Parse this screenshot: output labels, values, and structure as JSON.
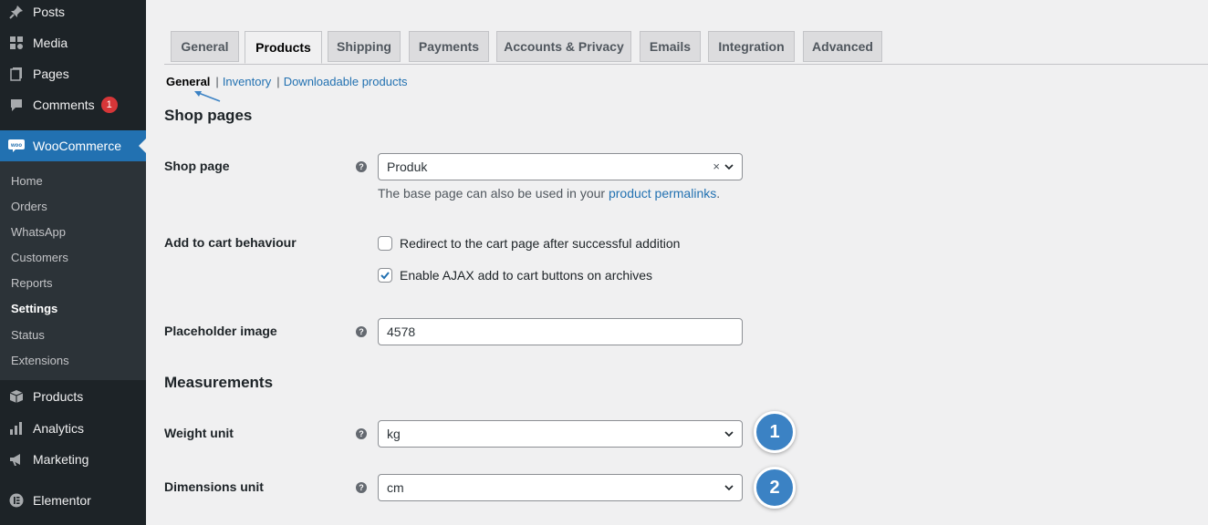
{
  "sidebar": {
    "top_items": [
      {
        "label": "Posts",
        "icon": "pin-icon"
      },
      {
        "label": "Media",
        "icon": "media-icon"
      },
      {
        "label": "Pages",
        "icon": "pages-icon"
      },
      {
        "label": "Comments",
        "icon": "comment-icon",
        "badge": "1"
      }
    ],
    "woocommerce": {
      "label": "WooCommerce",
      "icon_text": "woo"
    },
    "submenu": [
      "Home",
      "Orders",
      "WhatsApp",
      "Customers",
      "Reports",
      "Settings",
      "Status",
      "Extensions"
    ],
    "current_submenu": "Settings",
    "bottom_items": [
      {
        "label": "Products",
        "icon": "box-icon"
      },
      {
        "label": "Analytics",
        "icon": "bar-chart-icon"
      },
      {
        "label": "Marketing",
        "icon": "megaphone-icon"
      },
      {
        "label": "Elementor",
        "icon": "elementor-icon"
      }
    ]
  },
  "tabs": [
    "General",
    "Products",
    "Shipping",
    "Payments",
    "Accounts & Privacy",
    "Emails",
    "Integration",
    "Advanced"
  ],
  "active_tab": "Products",
  "subsub": {
    "current": "General",
    "separator": "|",
    "links": [
      "Inventory",
      "Downloadable products"
    ]
  },
  "shop_pages": {
    "heading": "Shop pages",
    "shop_page_label": "Shop page",
    "shop_page_value": "Produk",
    "description_prefix": "The base page can also be used in your ",
    "description_link": "product permalinks",
    "description_suffix": ".",
    "add_to_cart_label": "Add to cart behaviour",
    "redirect_label": "Redirect to the cart page after successful addition",
    "redirect_checked": false,
    "ajax_label": "Enable AJAX add to cart buttons on archives",
    "ajax_checked": true,
    "placeholder_label": "Placeholder image",
    "placeholder_value": "4578"
  },
  "measurements": {
    "heading": "Measurements",
    "weight_label": "Weight unit",
    "weight_value": "kg",
    "dimensions_label": "Dimensions unit",
    "dimensions_value": "cm"
  },
  "help_glyph": "?",
  "clear_glyph": "×",
  "markers": [
    "1",
    "2"
  ],
  "colors": {
    "accent": "#2271b1",
    "sidebar": "#1d2327",
    "badge": "#d63638",
    "marker": "#3b82c4"
  }
}
